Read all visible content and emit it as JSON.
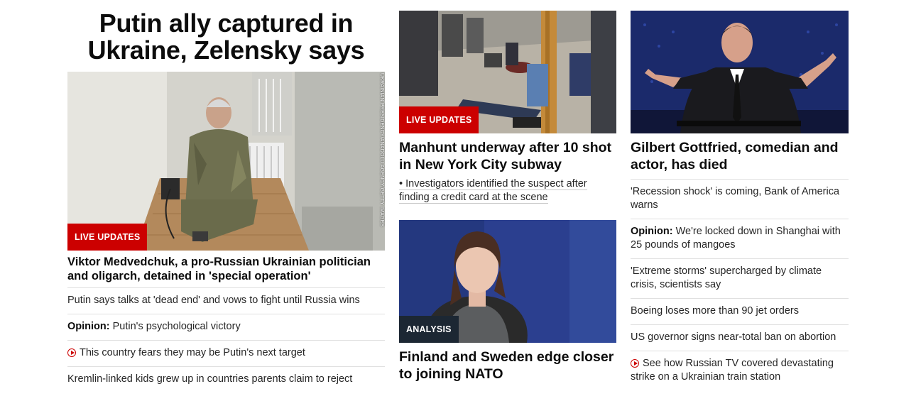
{
  "colors": {
    "accent_red": "#cc0000",
    "analysis_badge": "#1c2733",
    "text": "#0c0c0c",
    "divider": "#e0e0e0"
  },
  "left": {
    "headline": "Putin ally captured in Ukraine, Zelensky says",
    "badge": "LIVE UPDATES",
    "photo_credit": "UKRAINIAN PRESIDENCY/ANADOLU AGENCY/GETTY IMAGES",
    "story_title": "Viktor Medvedchuk, a pro-Russian Ukrainian politician and oligarch, detained in 'special operation'",
    "items": [
      {
        "text": "Putin says talks at 'dead end' and vows to fight until Russia wins"
      },
      {
        "prefix": "Opinion:",
        "text": " Putin's psychological victory"
      },
      {
        "icon": "play-icon",
        "text": "This country fears they may be Putin's next target"
      },
      {
        "text": "Kremlin-linked kids grew up in countries parents claim to reject"
      }
    ]
  },
  "middle": {
    "story1": {
      "badge": "LIVE UPDATES",
      "title": "Manhunt underway after 10 shot in New York City subway",
      "sublink": "Investigators identified the suspect after finding a credit card at the scene",
      "bullet": "•"
    },
    "story2": {
      "badge": "ANALYSIS",
      "title": "Finland and Sweden edge closer to joining NATO"
    }
  },
  "right": {
    "story_title": "Gilbert Gottfried, comedian and actor, has died",
    "items": [
      {
        "text": "'Recession shock' is coming, Bank of America warns"
      },
      {
        "prefix": "Opinion:",
        "text": " We're locked down in Shanghai with 25 pounds of mangoes"
      },
      {
        "text": "'Extreme storms' supercharged by climate crisis, scientists say"
      },
      {
        "text": "Boeing loses more than 90 jet orders"
      },
      {
        "text": "US governor signs near-total ban on abortion"
      },
      {
        "icon": "play-icon",
        "text": "See how Russian TV covered devastating strike on a Ukrainian train station"
      }
    ]
  }
}
